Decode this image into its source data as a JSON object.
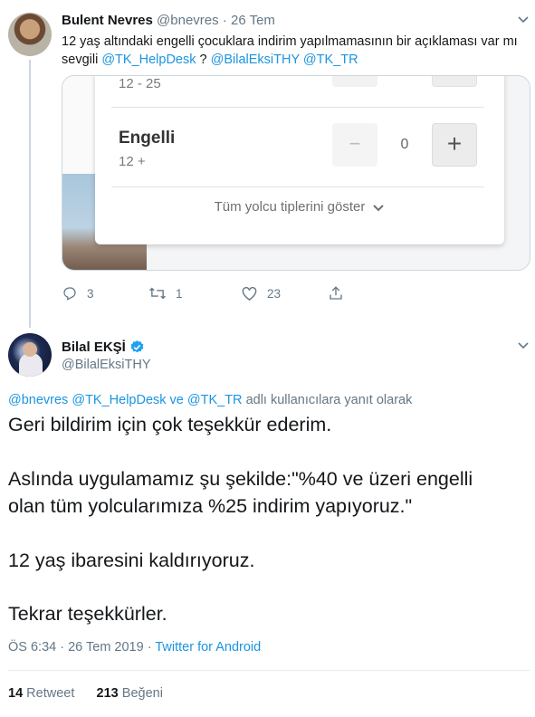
{
  "parent_tweet": {
    "name": "Bulent Nevres",
    "handle": "@bnevres",
    "separator": "·",
    "date": "26 Tem",
    "text_plain_1": "12 yaş altındaki engelli çocuklara indirim yapılmamasının bir açıklaması var mı",
    "text_plain_2": "sevgili ",
    "mention_1": "@TK_HelpDesk",
    "text_plain_3": " ? ",
    "mention_2": "@BilalEksiTHY",
    "mention_3": "@TK_TR",
    "media": {
      "age_range_top": "12 - 25",
      "passenger_label": "Engelli",
      "age_range": "12 +",
      "minus_symbol": "−",
      "count": "0",
      "plus_symbol": "+",
      "show_all": "Tüm yolcu tiplerini göster"
    },
    "replies": "3",
    "retweets": "1",
    "likes": "23"
  },
  "main_tweet": {
    "name": "Bilal EKŞİ",
    "handle": "@BilalEksiTHY",
    "reply_to": {
      "mention_1": "@bnevres",
      "mention_2": "@TK_HelpDesk",
      "joiner": " ve ",
      "mention_3": "@TK_TR",
      "suffix": " adlı kullanıcılara yanıt olarak"
    },
    "paragraphs": [
      "Geri bildirim için çok teşekkür ederim.",
      "Aslında uygulamamız şu şekilde:\"%40 ve üzeri engelli",
      "olan tüm yolcularımıza %25 indirim yapıyoruz.\"",
      "12 yaş ibaresini kaldırıyoruz.",
      "Tekrar teşekkürler."
    ],
    "time": "ÖS 6:34",
    "date": "26 Tem 2019",
    "source": "Twitter for Android",
    "retweet_count": "14",
    "retweet_label": "Retweet",
    "like_count": "213",
    "like_label": "Beğeni"
  },
  "colors": {
    "link": "#1b95e0",
    "muted": "#657786",
    "text": "#14171a",
    "verified": "#1da1f2"
  }
}
